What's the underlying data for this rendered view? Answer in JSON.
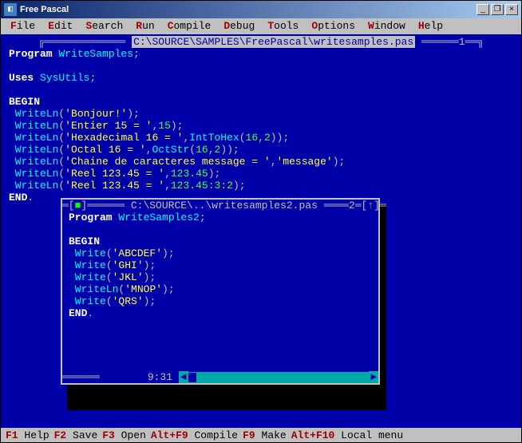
{
  "window": {
    "title": "Free Pascal"
  },
  "winbtns": {
    "min": "_",
    "restore": "❐",
    "close": "×"
  },
  "menu": [
    {
      "hot": "F",
      "rest": "ile"
    },
    {
      "hot": "E",
      "rest": "dit"
    },
    {
      "hot": "S",
      "rest": "earch"
    },
    {
      "hot": "R",
      "rest": "un"
    },
    {
      "hot": "C",
      "rest": "ompile"
    },
    {
      "hot": "D",
      "rest": "ebug"
    },
    {
      "hot": "T",
      "rest": "ools"
    },
    {
      "hot": "O",
      "rest": "ptions"
    },
    {
      "hot": "W",
      "rest": "indow"
    },
    {
      "hot": "H",
      "rest": "elp"
    }
  ],
  "editor1": {
    "path": "C:\\SOURCE\\SAMPLES\\FreePascal\\writesamples.pas",
    "winnum": "1",
    "lines": [
      [
        {
          "t": "Program ",
          "c": "kw"
        },
        {
          "t": "WriteSamples",
          "c": "fn"
        },
        {
          "t": ";",
          "c": "sym"
        }
      ],
      [
        {
          "t": "",
          "c": "sym"
        }
      ],
      [
        {
          "t": "Uses ",
          "c": "kw"
        },
        {
          "t": "SysUtils",
          "c": "fn"
        },
        {
          "t": ";",
          "c": "sym"
        }
      ],
      [
        {
          "t": "",
          "c": "sym"
        }
      ],
      [
        {
          "t": "BEGIN",
          "c": "kw"
        }
      ],
      [
        {
          "t": " WriteLn",
          "c": "fn"
        },
        {
          "t": "(",
          "c": "sym"
        },
        {
          "t": "'Bonjour!'",
          "c": "str"
        },
        {
          "t": ");",
          "c": "sym"
        }
      ],
      [
        {
          "t": " WriteLn",
          "c": "fn"
        },
        {
          "t": "(",
          "c": "sym"
        },
        {
          "t": "'Entier 15 = '",
          "c": "str"
        },
        {
          "t": ",",
          "c": "sym"
        },
        {
          "t": "15",
          "c": "num"
        },
        {
          "t": ");",
          "c": "sym"
        }
      ],
      [
        {
          "t": " WriteLn",
          "c": "fn"
        },
        {
          "t": "(",
          "c": "sym"
        },
        {
          "t": "'Hexadecimal 16 = '",
          "c": "str"
        },
        {
          "t": ",",
          "c": "sym"
        },
        {
          "t": "IntToHex",
          "c": "fn"
        },
        {
          "t": "(",
          "c": "sym"
        },
        {
          "t": "16",
          "c": "num"
        },
        {
          "t": ",",
          "c": "sym"
        },
        {
          "t": "2",
          "c": "num"
        },
        {
          "t": "));",
          "c": "sym"
        }
      ],
      [
        {
          "t": " WriteLn",
          "c": "fn"
        },
        {
          "t": "(",
          "c": "sym"
        },
        {
          "t": "'Octal 16 = '",
          "c": "str"
        },
        {
          "t": ",",
          "c": "sym"
        },
        {
          "t": "OctStr",
          "c": "fn"
        },
        {
          "t": "(",
          "c": "sym"
        },
        {
          "t": "16",
          "c": "num"
        },
        {
          "t": ",",
          "c": "sym"
        },
        {
          "t": "2",
          "c": "num"
        },
        {
          "t": "));",
          "c": "sym"
        }
      ],
      [
        {
          "t": " WriteLn",
          "c": "fn"
        },
        {
          "t": "(",
          "c": "sym"
        },
        {
          "t": "'Chaine de caracteres message = '",
          "c": "str"
        },
        {
          "t": ",",
          "c": "sym"
        },
        {
          "t": "'message'",
          "c": "str"
        },
        {
          "t": ");",
          "c": "sym"
        }
      ],
      [
        {
          "t": " WriteLn",
          "c": "fn"
        },
        {
          "t": "(",
          "c": "sym"
        },
        {
          "t": "'Reel 123.45 = '",
          "c": "str"
        },
        {
          "t": ",",
          "c": "sym"
        },
        {
          "t": "123.45",
          "c": "num"
        },
        {
          "t": ");",
          "c": "sym"
        }
      ],
      [
        {
          "t": " WriteLn",
          "c": "fn"
        },
        {
          "t": "(",
          "c": "sym"
        },
        {
          "t": "'Reel 123.45 = '",
          "c": "str"
        },
        {
          "t": ",",
          "c": "sym"
        },
        {
          "t": "123.45",
          "c": "num"
        },
        {
          "t": ":",
          "c": "sym"
        },
        {
          "t": "3",
          "c": "num"
        },
        {
          "t": ":",
          "c": "sym"
        },
        {
          "t": "2",
          "c": "num"
        },
        {
          "t": ");",
          "c": "sym"
        }
      ],
      [
        {
          "t": "END",
          "c": "kw"
        },
        {
          "t": ".",
          "c": "sym"
        }
      ]
    ]
  },
  "editor2": {
    "path": "C:\\SOURCE\\..\\writesamples2.pas",
    "winnum": "2",
    "cursor": "9:31",
    "lines": [
      [
        {
          "t": "Program ",
          "c": "kw"
        },
        {
          "t": "WriteSamples2",
          "c": "fn"
        },
        {
          "t": ";",
          "c": "sym"
        }
      ],
      [
        {
          "t": "",
          "c": "sym"
        }
      ],
      [
        {
          "t": "BEGIN",
          "c": "kw"
        }
      ],
      [
        {
          "t": " Write",
          "c": "fn"
        },
        {
          "t": "(",
          "c": "sym"
        },
        {
          "t": "'ABCDEF'",
          "c": "str"
        },
        {
          "t": ");",
          "c": "sym"
        }
      ],
      [
        {
          "t": " Write",
          "c": "fn"
        },
        {
          "t": "(",
          "c": "sym"
        },
        {
          "t": "'GHI'",
          "c": "str"
        },
        {
          "t": ");",
          "c": "sym"
        }
      ],
      [
        {
          "t": " Write",
          "c": "fn"
        },
        {
          "t": "(",
          "c": "sym"
        },
        {
          "t": "'JKL'",
          "c": "str"
        },
        {
          "t": ");",
          "c": "sym"
        }
      ],
      [
        {
          "t": " WriteLn",
          "c": "fn"
        },
        {
          "t": "(",
          "c": "sym"
        },
        {
          "t": "'MNOP'",
          "c": "str"
        },
        {
          "t": ");",
          "c": "sym"
        }
      ],
      [
        {
          "t": " Write",
          "c": "fn"
        },
        {
          "t": "(",
          "c": "sym"
        },
        {
          "t": "'QRS'",
          "c": "str"
        },
        {
          "t": ");",
          "c": "sym"
        }
      ],
      [
        {
          "t": "END",
          "c": "kw"
        },
        {
          "t": ".",
          "c": "sym"
        }
      ]
    ]
  },
  "status": [
    {
      "fk": "F1",
      "label": " Help"
    },
    {
      "fk": "F2",
      "label": " Save"
    },
    {
      "fk": "F3",
      "label": " Open"
    },
    {
      "fk": "Alt+F9",
      "label": " Compile"
    },
    {
      "fk": "F9",
      "label": " Make"
    },
    {
      "fk": "Alt+F10",
      "label": " Local menu"
    }
  ]
}
